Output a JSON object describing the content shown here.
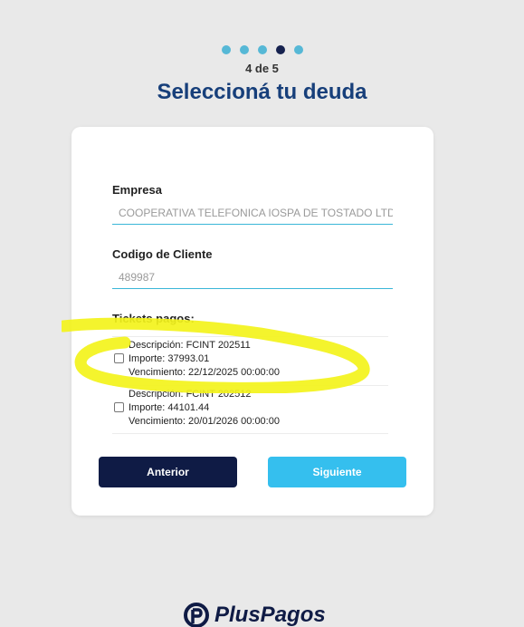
{
  "stepper": {
    "total": 5,
    "current": 4,
    "text": "4 de 5"
  },
  "title": "Seleccioná tu deuda",
  "form": {
    "empresa_label": "Empresa",
    "empresa_value": "COOPERATIVA TELEFONICA IOSPA DE TOSTADO LTDA",
    "cliente_label": "Codigo de Cliente",
    "cliente_value": "489987",
    "tickets_label": "Tickets pagos:",
    "tickets": [
      {
        "descripcion": "Descripción: FCINT 202511",
        "importe": "Importe: 37993.01",
        "vencimiento": "Vencimiento: 22/12/2025 00:00:00",
        "checked": false
      },
      {
        "descripcion": "Descripción: FCINT 202512",
        "importe": "Importe: 44101.44",
        "vencimiento": "Vencimiento: 20/01/2026 00:00:00",
        "checked": false
      }
    ]
  },
  "buttons": {
    "prev_label": "Anterior",
    "next_label": "Siguiente"
  },
  "footer": {
    "brand": "PlusPagos"
  },
  "colors": {
    "background": "#e9e9e9",
    "title": "#173f7a",
    "dot": "#56b8d6",
    "dot_active": "#16224f",
    "prev_button": "#0f1b45",
    "next_button": "#35bfee",
    "highlight": "#f3f31b"
  }
}
